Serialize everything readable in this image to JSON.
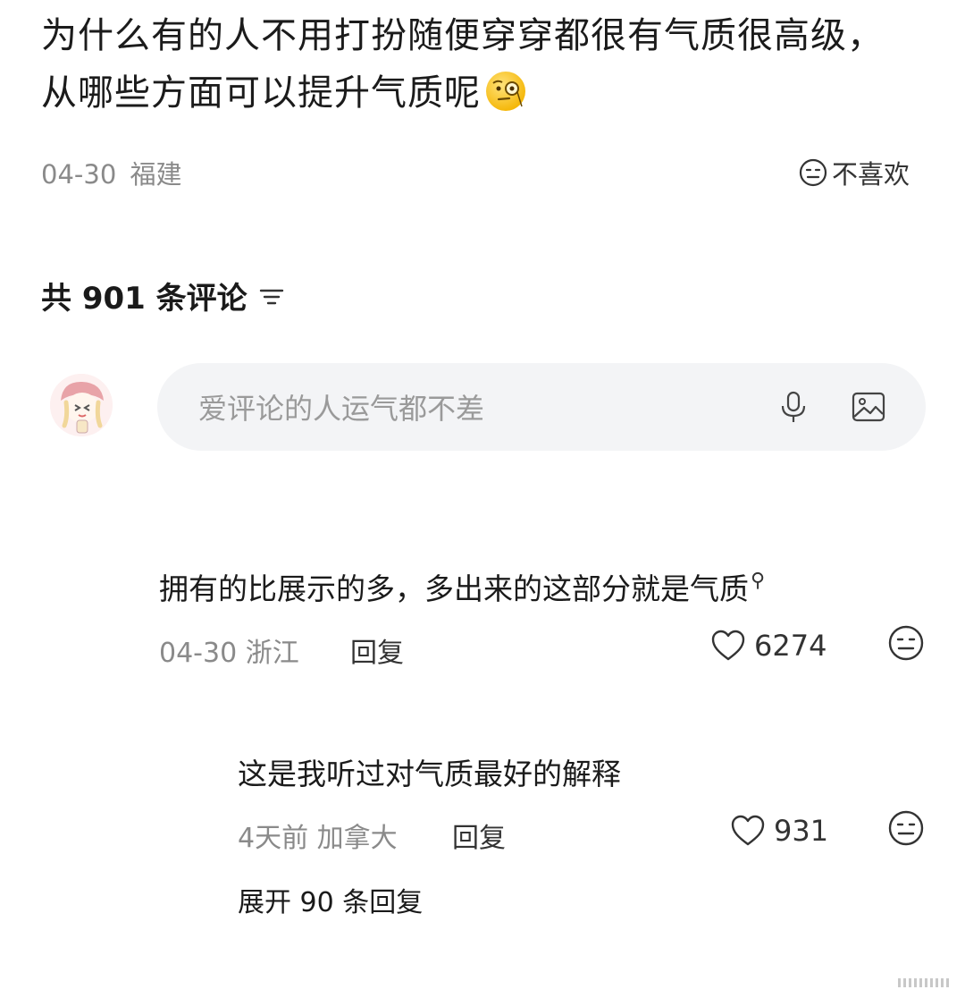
{
  "post": {
    "title": "为什么有的人不用打扮随便穿穿都很有气质很高级，从哪些方面可以提升气质呢",
    "emoji": "monocle-face-emoji",
    "date": "04-30",
    "location": "福建",
    "dislike_label": "不喜欢"
  },
  "comments_header": {
    "count_label": "共 901 条评论"
  },
  "comment_input": {
    "placeholder": "爱评论的人运气都不差"
  },
  "top_comment": {
    "text": "拥有的比展示的多，多出来的这部分就是气质",
    "date": "04-30",
    "location": "浙江",
    "reply_label": "回复",
    "likes": "6274"
  },
  "reply": {
    "text": "这是我听过对气质最好的解释",
    "date": "4天前",
    "location": "加拿大",
    "reply_label": "回复",
    "likes": "931"
  },
  "expand_label": "展开 90 条回复",
  "colors": {
    "input_bg": "#f3f4f6",
    "meta_gray": "#8a8a8a",
    "text": "#1b1b1b"
  }
}
